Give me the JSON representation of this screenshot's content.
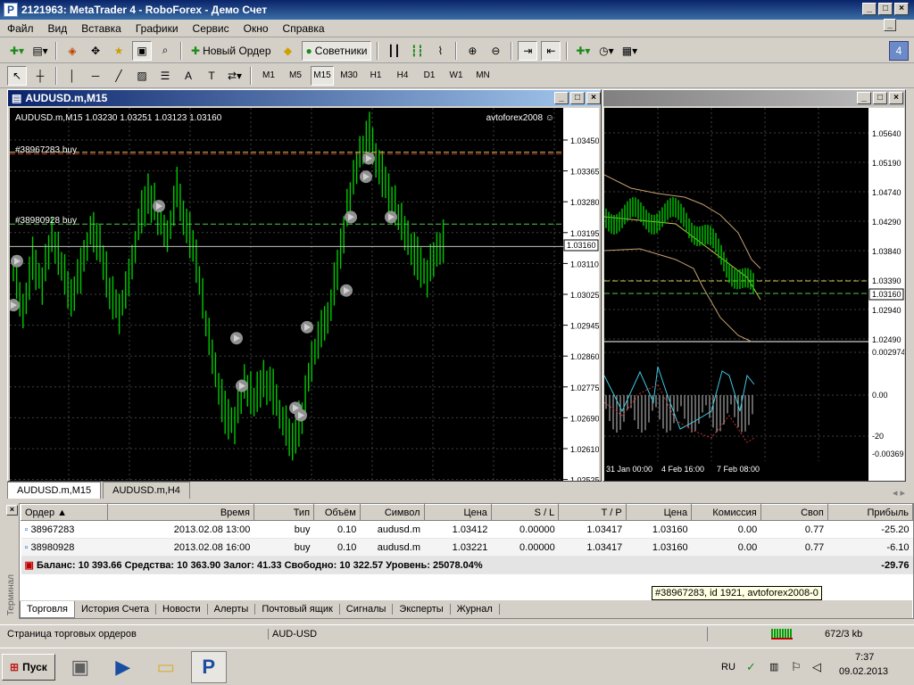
{
  "window": {
    "title": "2121963: MetaTrader 4 - RoboForex - Демо Счет"
  },
  "menu": [
    "Файл",
    "Вид",
    "Вставка",
    "Графики",
    "Сервис",
    "Окно",
    "Справка"
  ],
  "toolbar": {
    "new_order": "Новый Ордер",
    "advisors": "Советники",
    "info_badge": "4"
  },
  "timeframes": [
    "M1",
    "M5",
    "M15",
    "M30",
    "H1",
    "H4",
    "D1",
    "W1",
    "MN"
  ],
  "active_timeframe": "M15",
  "chart1": {
    "title": "AUDUSD.m,M15",
    "info": "AUDUSD.m,M15  1.03230 1.03251 1.03123 1.03160",
    "advisor": "avtoforex2008 ☺",
    "order1_label": "#38967283 buy",
    "order2_label": "#38980928 buy",
    "price_ticks": [
      "1.03450",
      "1.03365",
      "1.03280",
      "1.03195",
      "1.03110",
      "1.03025",
      "1.02945",
      "1.02860",
      "1.02775",
      "1.02690",
      "1.02610",
      "1.02525"
    ],
    "current_price": "1.03160"
  },
  "chart2": {
    "price_ticks": [
      "1.05640",
      "1.05190",
      "1.04740",
      "1.04290",
      "1.03840",
      "1.03390",
      "1.02940",
      "1.02490"
    ],
    "current_price": "1.03160",
    "osc_ticks": [
      "0.002974",
      "0.00",
      "-20",
      "-0.00369"
    ],
    "time_ticks": [
      "31 Jan 00:00",
      "4 Feb 16:00",
      "7 Feb 08:00"
    ]
  },
  "chart_tabs": [
    "AUDUSD.m,M15",
    "AUDUSD.m,H4"
  ],
  "orders": {
    "columns": [
      "Ордер",
      "Время",
      "Тип",
      "Объём",
      "Символ",
      "Цена",
      "S / L",
      "T / P",
      "Цена",
      "Комиссия",
      "Своп",
      "Прибыль"
    ],
    "rows": [
      {
        "order": "38967283",
        "time": "2013.02.08 13:00",
        "type": "buy",
        "volume": "0.10",
        "symbol": "audusd.m",
        "price": "1.03412",
        "sl": "0.00000",
        "tp": "1.03417",
        "cur": "1.03160",
        "commission": "0.00",
        "swap": "0.77",
        "profit": "-25.20"
      },
      {
        "order": "38980928",
        "time": "2013.02.08 16:00",
        "type": "buy",
        "volume": "0.10",
        "symbol": "audusd.m",
        "price": "1.03221",
        "sl": "0.00000",
        "tp": "1.03417",
        "cur": "1.03160",
        "commission": "0.00",
        "swap": "0.77",
        "profit": "-6.10"
      }
    ],
    "balance_line": "Баланс: 10 393.66  Средства: 10 363.90  Залог: 41.33  Свободно: 10 322.57  Уровень: 25078.04%",
    "total_profit": "-29.76"
  },
  "tooltip": "#38967283, id 1921, avtoforex2008-0",
  "terminal_side": "Терминал",
  "bottom_tabs": [
    "Торговля",
    "История Счета",
    "Новости",
    "Алерты",
    "Почтовый ящик",
    "Сигналы",
    "Эксперты",
    "Журнал"
  ],
  "status": {
    "left": "Страница торговых ордеров",
    "symbol": "AUD-USD",
    "traffic": "672/3 kb"
  },
  "taskbar": {
    "start": "Пуск",
    "lang": "RU",
    "time": "7:37",
    "date": "09.02.2013"
  },
  "colors": {
    "bull": "#00c800",
    "bid_line": "#c0c0c0",
    "order_line": "#c8c850",
    "chart_bg": "#000000"
  }
}
